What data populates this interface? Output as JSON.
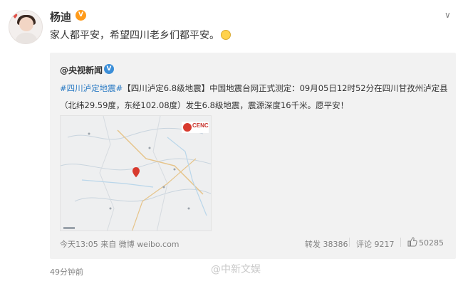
{
  "user": {
    "name": "杨迪",
    "verified_color": "#ff9b1a"
  },
  "post": {
    "text": "家人都平安，希望四川老乡们都平安。",
    "emoji_icon": "praying-emoji-icon",
    "time_ago": "49分钟前"
  },
  "repost": {
    "author": "@央视新闻",
    "author_badge_color": "#3b8ed8",
    "hashtag": "#四川泸定地震#",
    "line1_rest": "【四川泸定6.8级地震】中国地震台网正式测定：09月05日12时52分在四川甘孜州泸定县",
    "line2": "（北纬29.59度，东经102.08度）发生6.8级地震，震源深度16千米。愿平安！",
    "map_logo": "CENC",
    "footer_source": "今天13:05 来自 微博 weibo.com",
    "repost_count": "转发 38386",
    "comment_count": "评论 9217",
    "like_count": "50285"
  },
  "watermark": "@中新文娱",
  "colors": {
    "link": "#2b7bc4",
    "epicenter": "#d83a2e"
  }
}
